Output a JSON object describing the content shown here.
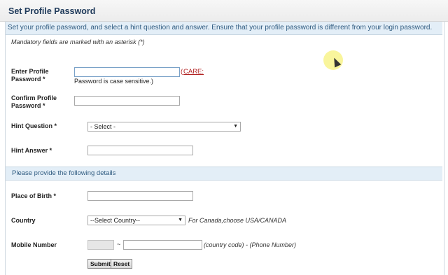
{
  "header": {
    "title": "Set Profile Password"
  },
  "intro": "Set your profile password, and select a hint question and answer. Ensure that your profile password is different from your login password.",
  "mandatory_note": "Mandatory fields are marked with an asterisk (*)",
  "fields": {
    "profile_password": {
      "label_line1": "Enter Profile",
      "label_line2": "Password *",
      "value": ""
    },
    "care_paren": "(",
    "care_link": "CARE:",
    "case_note": "Password is case sensitive.)",
    "confirm_password": {
      "label_line1": "Confirm Profile",
      "label_line2": "Password *",
      "value": ""
    },
    "hint_question": {
      "label": "Hint Question *",
      "selected": "- Select -"
    },
    "hint_answer": {
      "label": "Hint Answer *",
      "value": ""
    }
  },
  "section2": {
    "title": "Please provide the following details"
  },
  "details": {
    "place_of_birth": {
      "label": "Place of Birth *",
      "value": ""
    },
    "country": {
      "label": "Country",
      "selected": "--Select Country--",
      "note": "For Canada,choose USA/CANADA"
    },
    "mobile": {
      "label": "Mobile Number",
      "separator": "~",
      "note": "(country code) - (Phone Number)"
    }
  },
  "buttons": {
    "submit": "Submit",
    "reset": "Reset"
  },
  "icons": {
    "dropdown": "triangle-down-icon",
    "cursor": "mouse-pointer-icon"
  }
}
